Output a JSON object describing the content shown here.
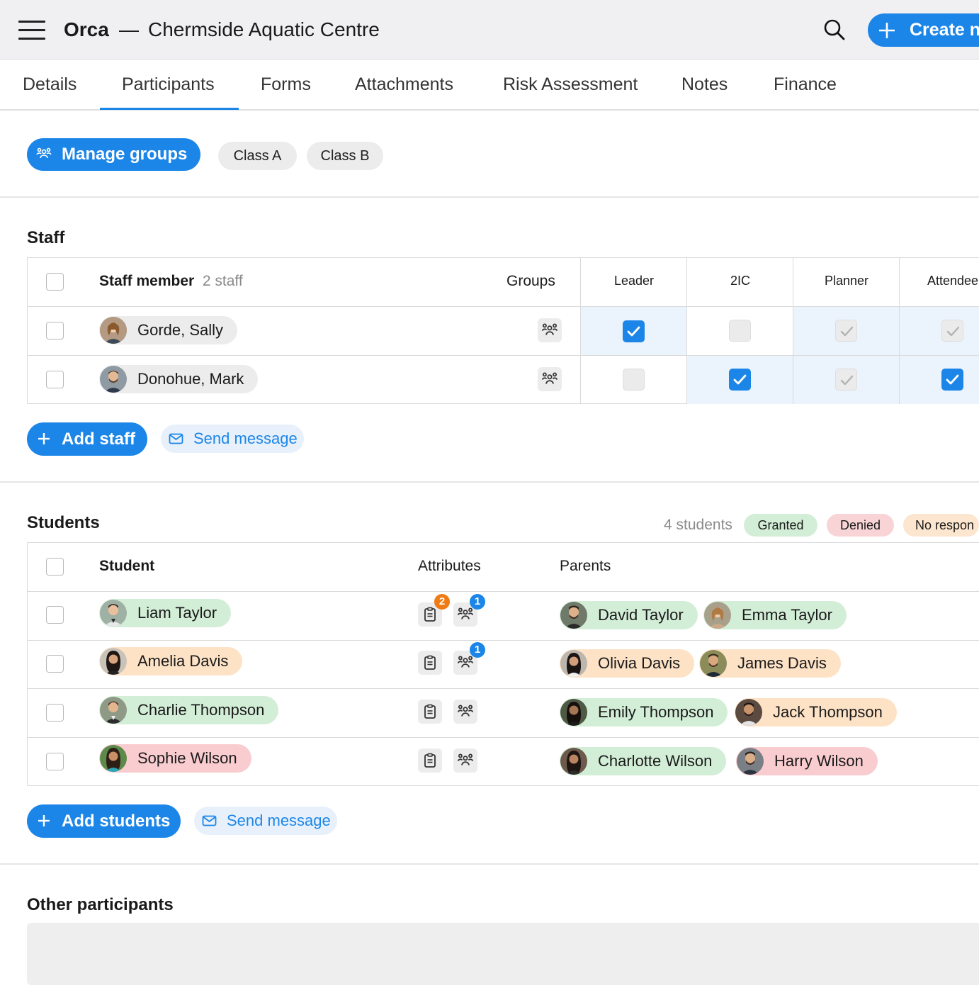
{
  "header": {
    "app_name": "Orca",
    "separator": "—",
    "title": "Chermside Aquatic Centre",
    "create_label": "Create ne"
  },
  "tabs": [
    "Details",
    "Participants",
    "Forms",
    "Attachments",
    "Risk Assessment",
    "Notes",
    "Finance"
  ],
  "active_tab": "Participants",
  "groups": {
    "manage_label": "Manage groups",
    "chips": [
      "Class A",
      "Class B"
    ]
  },
  "staff": {
    "title": "Staff",
    "col_member": "Staff member",
    "count": "2 staff",
    "col_groups": "Groups",
    "roles": [
      "Leader",
      "2IC",
      "Planner",
      "Attendee"
    ],
    "rows": [
      {
        "name": "Gorde, Sally",
        "leader": "checked",
        "second": "unchecked",
        "planner": "auto",
        "attendee": "auto"
      },
      {
        "name": "Donohue, Mark",
        "leader": "unchecked",
        "second": "checked",
        "planner": "auto",
        "attendee": "checked"
      }
    ],
    "add_label": "Add staff",
    "message_label": "Send message"
  },
  "students": {
    "title": "Students",
    "count": "4 students",
    "consent": [
      "Granted",
      "Denied",
      "No respon"
    ],
    "col_student": "Student",
    "col_attributes": "Attributes",
    "col_parents": "Parents",
    "rows": [
      {
        "name": "Liam Taylor",
        "status": "granted",
        "form_badge": "2",
        "group_badge": "1",
        "parents": [
          {
            "name": "David Taylor",
            "status": "granted"
          },
          {
            "name": "Emma Taylor",
            "status": "granted"
          }
        ]
      },
      {
        "name": "Amelia Davis",
        "status": "no-response",
        "form_badge": "",
        "group_badge": "1",
        "parents": [
          {
            "name": "Olivia Davis",
            "status": "no-response"
          },
          {
            "name": "James Davis",
            "status": "no-response"
          }
        ]
      },
      {
        "name": "Charlie Thompson",
        "status": "granted",
        "form_badge": "",
        "group_badge": "",
        "parents": [
          {
            "name": "Emily Thompson",
            "status": "granted"
          },
          {
            "name": "Jack Thompson",
            "status": "no-response"
          }
        ]
      },
      {
        "name": "Sophie Wilson",
        "status": "denied",
        "form_badge": "",
        "group_badge": "",
        "parents": [
          {
            "name": "Charlotte Wilson",
            "status": "granted"
          },
          {
            "name": "Harry Wilson",
            "status": "denied"
          }
        ]
      }
    ],
    "add_label": "Add students",
    "message_label": "Send message"
  },
  "other": {
    "title": "Other participants"
  },
  "colors": {
    "accent": "#1c86e8",
    "granted": "#d3eed7",
    "denied": "#f9cccf",
    "no_response": "#fde2c6",
    "neutral": "#ececec"
  },
  "icons": [
    "hamburger-icon",
    "search-icon",
    "plus-icon",
    "people-group-icon",
    "check-icon",
    "clipboard-icon",
    "mail-icon"
  ]
}
